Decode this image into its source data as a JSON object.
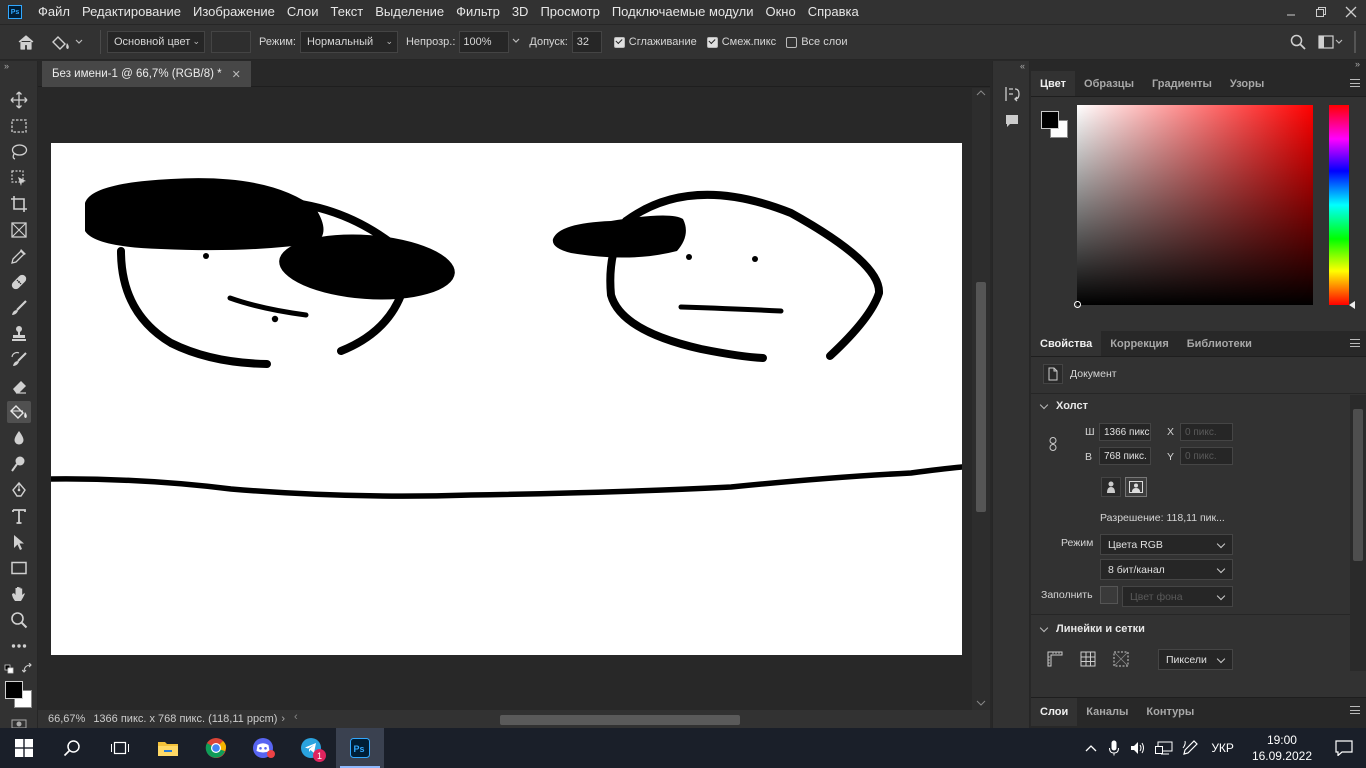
{
  "menu": {
    "logo": "Ps",
    "items": [
      "Файл",
      "Редактирование",
      "Изображение",
      "Слои",
      "Текст",
      "Выделение",
      "Фильтр",
      "3D",
      "Просмотр",
      "Подключаемые модули",
      "Окно",
      "Справка"
    ]
  },
  "options": {
    "fill_source": "Основной цвет",
    "mode_label": "Режим:",
    "mode_value": "Нормальный",
    "opacity_label": "Непрозр.:",
    "opacity_value": "100%",
    "tolerance_label": "Допуск:",
    "tolerance_value": "32",
    "antialias_label": "Сглаживание",
    "antialias_checked": true,
    "contiguous_label": "Смеж.пикс",
    "contiguous_checked": true,
    "all_layers_label": "Все слои",
    "all_layers_checked": false
  },
  "document": {
    "tab_title": "Без имени-1 @ 66,7% (RGB/8) *",
    "status_zoom": "66,67%",
    "status_info": "1366 пикс. x 768 пикс. (118,11 ppcm)"
  },
  "tools": [
    "move-tool",
    "marquee-tool",
    "lasso-tool",
    "object-select-tool",
    "crop-tool",
    "frame-tool",
    "eyedropper-tool",
    "healing-brush-tool",
    "brush-tool",
    "clone-stamp-tool",
    "history-brush-tool",
    "eraser-tool",
    "paint-bucket-tool",
    "blur-tool",
    "dodge-tool",
    "pen-tool",
    "type-tool",
    "path-select-tool",
    "rectangle-tool",
    "hand-tool",
    "zoom-tool",
    "more-tools"
  ],
  "active_tool": "paint-bucket-tool",
  "colors": {
    "foreground": "#000000",
    "background": "#ffffff"
  },
  "color_panel": {
    "tabs": [
      "Цвет",
      "Образцы",
      "Градиенты",
      "Узоры"
    ],
    "hue": "#ff0000"
  },
  "properties_panel": {
    "tabs": [
      "Свойства",
      "Коррекция",
      "Библиотеки"
    ],
    "doc_label": "Документ",
    "canvas_section": "Холст",
    "width_label": "Ш",
    "width_value": "1366 пикс",
    "height_label": "В",
    "height_value": "768 пикс.",
    "x_label": "X",
    "x_value": "0 пикс.",
    "y_label": "Y",
    "y_value": "0 пикс.",
    "resolution": "Разрешение:  118,11 пик...",
    "mode_label": "Режим",
    "mode_value": "Цвета RGB",
    "depth_value": "8 бит/канал",
    "fill_label": "Заполнить",
    "fill_value": "Цвет фона",
    "rulers_section": "Линейки и сетки",
    "units_value": "Пиксели"
  },
  "layers_panel": {
    "tabs": [
      "Слои",
      "Каналы",
      "Контуры"
    ]
  },
  "taskbar": {
    "language": "УКР",
    "time": "19:00",
    "date": "16.09.2022",
    "telegram_badge": "1",
    "apps": [
      "start",
      "search",
      "task-view",
      "file-explorer",
      "chrome",
      "discord",
      "telegram",
      "photoshop"
    ],
    "active_app": "photoshop"
  }
}
